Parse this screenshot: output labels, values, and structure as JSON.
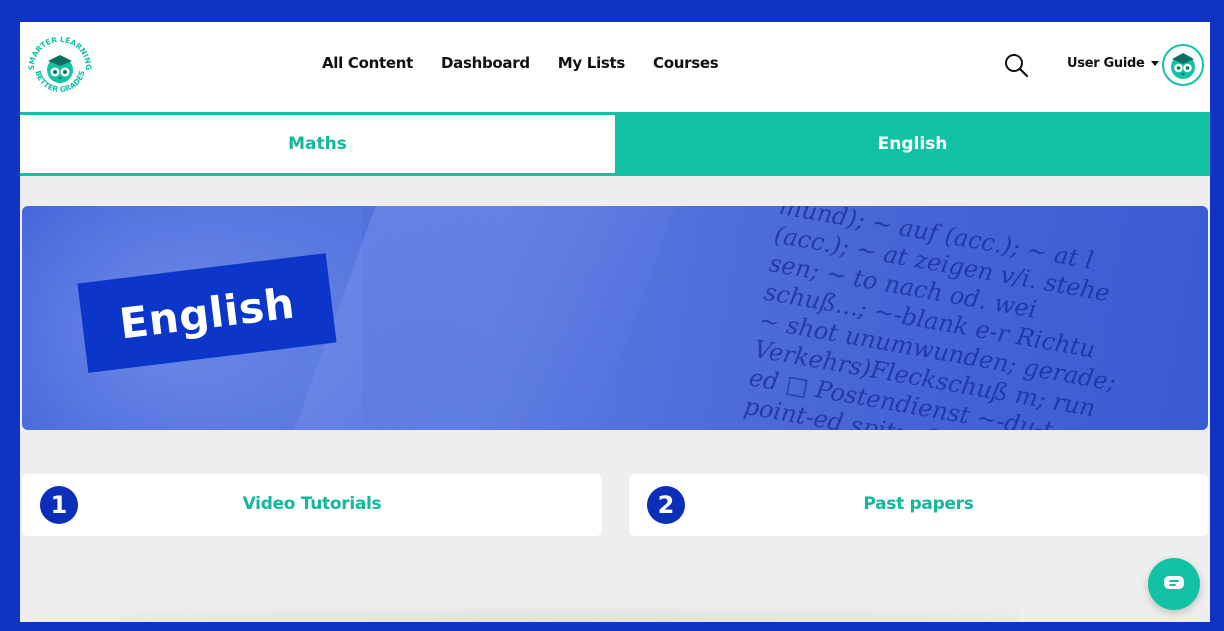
{
  "brand": {
    "logo_top_text": "SMARTER LEARNING",
    "logo_bottom_text": "BETTER GRADES"
  },
  "nav": {
    "items": [
      {
        "label": "All Content"
      },
      {
        "label": "Dashboard"
      },
      {
        "label": "My Lists"
      },
      {
        "label": "Courses"
      }
    ]
  },
  "header": {
    "user_guide_label": "User Guide",
    "search_icon": "search-icon",
    "avatar_icon": "owl-avatar"
  },
  "tabs": [
    {
      "label": "Maths",
      "active": false
    },
    {
      "label": "English",
      "active": true
    }
  ],
  "banner": {
    "title": "English"
  },
  "cards": [
    {
      "number": "1",
      "title": "Video Tutorials"
    },
    {
      "number": "2",
      "title": "Past papers"
    }
  ],
  "chat": {
    "icon": "chat-icon"
  },
  "colors": {
    "accent": "#13c2a5",
    "brand_blue": "#0b36c9",
    "frame": "#1133c4",
    "background": "#eeeeee"
  }
}
